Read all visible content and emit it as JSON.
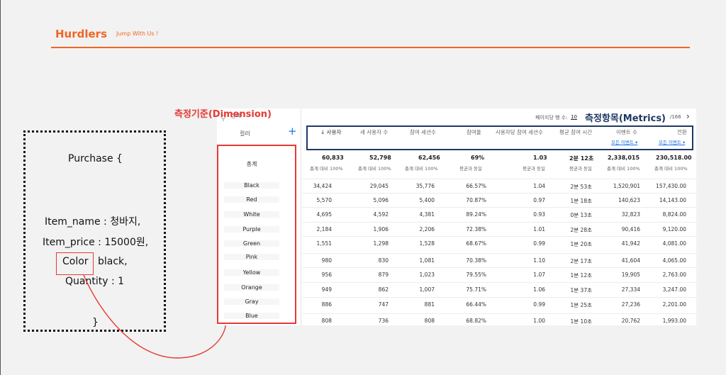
{
  "header": {
    "brand": "Hurdlers",
    "slogan": "Jump With Us !"
  },
  "code_box": {
    "lines": [
      "Purchase {",
      "Item_name : 청바지,",
      "Item_price : 15000원,",
      "Color",
      "black,",
      "Quantity : 1",
      "}"
    ]
  },
  "annotations": {
    "dimension_label": "측정기준(Dimension)",
    "metrics_label": "측정항목(Metrics)"
  },
  "colors": {
    "brand": "#f26522",
    "dimension_highlight": "#e53935",
    "metrics_highlight": "#1f3864",
    "link": "#1a73e8"
  },
  "table": {
    "search_placeholder": "검색",
    "dimension_header": "컬러",
    "total_label": "총계",
    "pager": {
      "rows_label": "페이지당 행 수:",
      "rows_value": "10",
      "range": "/166"
    },
    "metric_headers": [
      "↓ 사용자",
      "새 사용자 수",
      "참여 세션수",
      "참여율",
      "사용자당 참여 세션수",
      "평균 참여 시간",
      "이벤트 수",
      "전환"
    ],
    "metric_subheaders": [
      "모든 이벤트 ▾",
      "모든 이벤트 ▾"
    ],
    "totals": [
      "60,833",
      "52,798",
      "62,456",
      "69%",
      "1.03",
      "2분 12초",
      "2,338,015",
      "230,518.00"
    ],
    "total_notes": [
      "총계 대비 100%",
      "총계 대비 100%",
      "총계 대비 100%",
      "평균과 동일",
      "평균과 동일",
      "평균과 동일",
      "총계 대비 100%",
      "총계 대비 100%"
    ],
    "dimensions": [
      "Black",
      "Red",
      "White",
      "Purple",
      "Green",
      "Pink",
      "Yellow",
      "Orange",
      "Gray",
      "Blue"
    ],
    "rows": [
      [
        "34,424",
        "29,045",
        "35,776",
        "66.57%",
        "1.04",
        "2분 53초",
        "1,520,901",
        "157,430.00"
      ],
      [
        "5,570",
        "5,096",
        "5,400",
        "70.87%",
        "0.97",
        "1분 18초",
        "140,623",
        "14,143.00"
      ],
      [
        "4,695",
        "4,592",
        "4,381",
        "89.24%",
        "0.93",
        "0분 13초",
        "32,823",
        "8,824.00"
      ],
      [
        "2,184",
        "1,906",
        "2,206",
        "72.38%",
        "1.01",
        "2분 28초",
        "90,416",
        "9,120.00"
      ],
      [
        "1,551",
        "1,298",
        "1,528",
        "68.67%",
        "0.99",
        "1분 20초",
        "41,942",
        "4,081.00"
      ],
      [
        "980",
        "830",
        "1,081",
        "70.38%",
        "1.10",
        "2분 17초",
        "41,604",
        "4,065.00"
      ],
      [
        "956",
        "879",
        "1,023",
        "79.55%",
        "1.07",
        "1분 12초",
        "19,905",
        "2,763.00"
      ],
      [
        "949",
        "862",
        "1,007",
        "75.71%",
        "1.06",
        "1분 37초",
        "27,334",
        "3,247.00"
      ],
      [
        "886",
        "747",
        "881",
        "66.44%",
        "0.99",
        "1분 25초",
        "27,236",
        "2,201.00"
      ],
      [
        "808",
        "736",
        "808",
        "68.82%",
        "1.00",
        "1분 10초",
        "20,762",
        "1,993.00"
      ]
    ]
  }
}
